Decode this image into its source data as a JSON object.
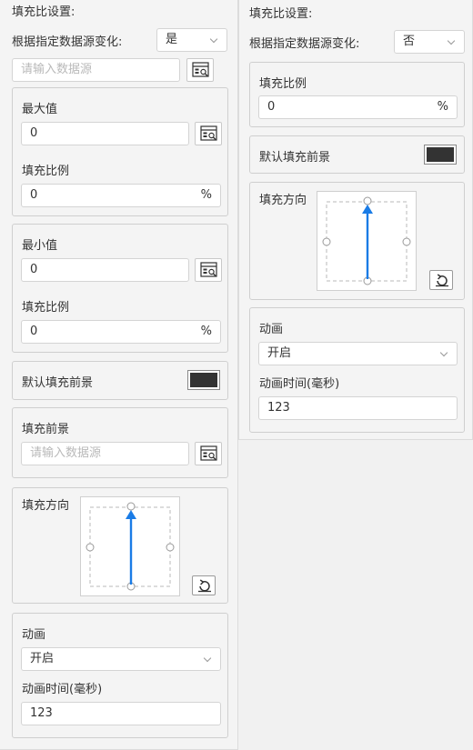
{
  "left": {
    "title": "填充比设置:",
    "follow_label": "根据指定数据源变化:",
    "follow_value": "是",
    "datasource_placeholder": "请输入数据源",
    "max": {
      "label": "最大值",
      "value": "0",
      "ratio_label": "填充比例",
      "ratio_value": "0",
      "ratio_unit": "%"
    },
    "min": {
      "label": "最小值",
      "value": "0",
      "ratio_label": "填充比例",
      "ratio_value": "0",
      "ratio_unit": "%"
    },
    "default_fg_label": "默认填充前景",
    "fill_fg": {
      "label": "填充前景",
      "placeholder": "请输入数据源"
    },
    "direction_label": "填充方向",
    "animation": {
      "label": "动画",
      "value": "开启",
      "time_label": "动画时间(毫秒)",
      "time_value": "123"
    }
  },
  "right": {
    "title": "填充比设置:",
    "follow_label": "根据指定数据源变化:",
    "follow_value": "否",
    "ratio_label": "填充比例",
    "ratio_value": "0",
    "ratio_unit": "%",
    "default_fg_label": "默认填充前景",
    "direction_label": "填充方向",
    "animation": {
      "label": "动画",
      "value": "开启",
      "time_label": "动画时间(毫秒)",
      "time_value": "123"
    }
  },
  "colors": {
    "default_foreground": "#333333",
    "arrow": "#1a7ce6"
  },
  "icons": {
    "bind": "datasource-bind-icon",
    "reset": "reset-icon",
    "chevron": "chevron-down-icon",
    "arrow": "arrow-up-icon"
  }
}
